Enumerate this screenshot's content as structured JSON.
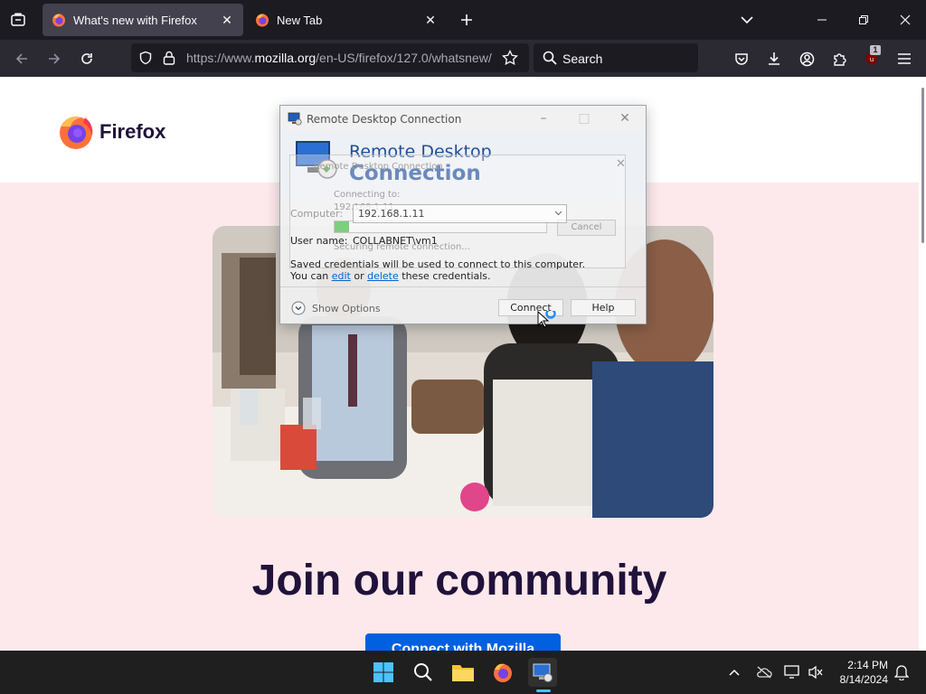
{
  "browser": {
    "tabs": [
      {
        "title": "What's new with Firefox",
        "active": true
      },
      {
        "title": "New Tab",
        "active": false
      }
    ],
    "url": {
      "prefix": "https://www.",
      "domain": "mozilla.org",
      "path": "/en-US/firefox/127.0/whatsnew/"
    },
    "search_placeholder": "Search",
    "extension_badge": "1"
  },
  "page": {
    "brand": "Firefox",
    "headline": "Join our community",
    "cta_label": "Connect with Mozilla"
  },
  "rdp": {
    "window_title": "Remote Desktop Connection",
    "banner_line1": "Remote Desktop",
    "banner_line2": "Connection",
    "ghost_title": "Remote Desktop Connection",
    "ghost_connecting": "Connecting to:",
    "ghost_host": "192.168.1.11",
    "ghost_status": "Securing remote connection...",
    "ghost_cancel": "Cancel",
    "computer_label": "Computer:",
    "computer_value": "192.168.1.11",
    "username_label": "User name:",
    "username_value": "COLLABNET\\vm1",
    "note_line1": "Saved credentials will be used to connect to this computer.",
    "note_you_can": "You can",
    "note_edit": "edit",
    "note_or": "or",
    "note_delete": "delete",
    "note_rest": "these credentials.",
    "show_options": "Show Options",
    "connect_label": "Connect",
    "help_label": "Help"
  },
  "taskbar": {
    "time": "2:14 PM",
    "date": "8/14/2024"
  },
  "colors": {
    "firefox_dark": "#1c1b22",
    "toolbar": "#2b2a33",
    "active_tab": "#42414d",
    "hero_bg": "#fde9ec",
    "headline": "#20123a",
    "cta": "#0060df",
    "rdp_blue": "#1f4e9c"
  }
}
